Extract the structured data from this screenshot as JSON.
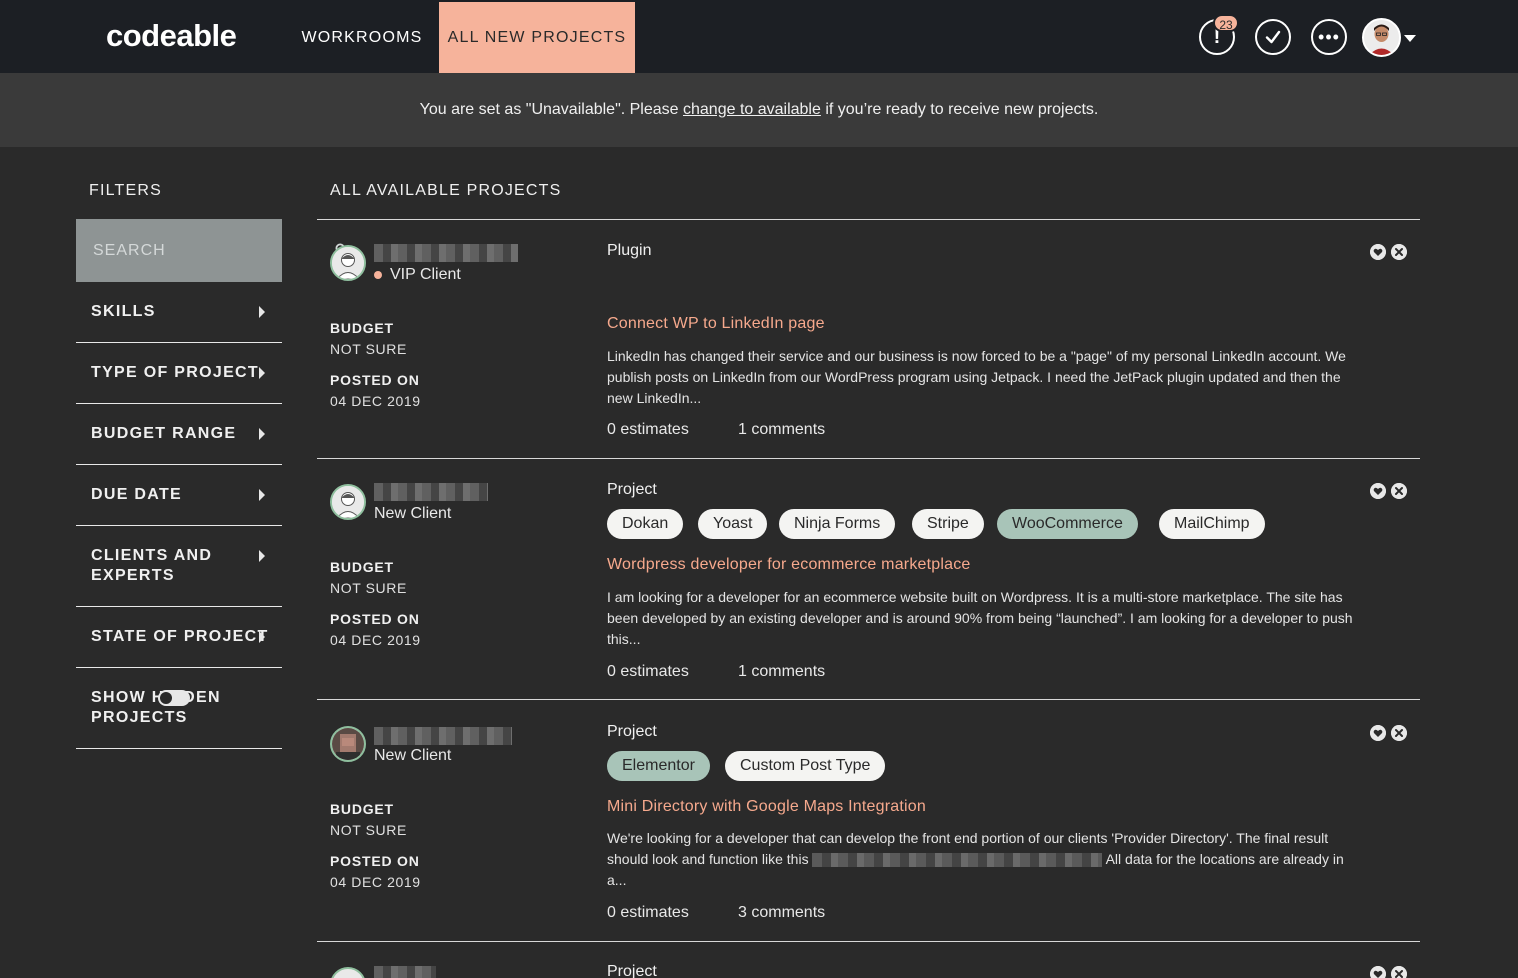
{
  "app": {
    "logo": "codeable"
  },
  "nav": {
    "workrooms": "WORKROOMS",
    "all_new_projects": "ALL NEW PROJECTS"
  },
  "header": {
    "notification_count": "23",
    "more_label": "•••"
  },
  "banner": {
    "prefix": "You are set as \"Unavailable\". Please ",
    "link": "change to available",
    "suffix": " if you’re ready to receive new projects."
  },
  "sidebar": {
    "title": "FILTERS",
    "search_placeholder": "SEARCH",
    "filters": [
      {
        "label": "SKILLS"
      },
      {
        "label": "TYPE OF PROJECT"
      },
      {
        "label": "BUDGET RANGE"
      },
      {
        "label": "DUE DATE"
      },
      {
        "label": "CLIENTS AND EXPERTS"
      },
      {
        "label": "STATE OF PROJECT"
      }
    ],
    "show_hidden": "SHOW HIDDEN PROJECTS",
    "show_hidden_on": false
  },
  "main": {
    "title": "ALL AVAILABLE PROJECTS",
    "projects": [
      {
        "client_type": "VIP Client",
        "budget_label": "BUDGET",
        "budget": "NOT SURE",
        "posted_label": "POSTED ON",
        "posted": "04 DEC 2019",
        "type": "Plugin",
        "tags": [],
        "title": "Connect WP to LinkedIn page",
        "description": "LinkedIn has changed their service and our business is now forced to be a \"page\" of my personal LinkedIn account. We publish posts on LinkedIn from our WordPress program using Jetpack. I need the JetPack plugin updated and then the new LinkedIn...",
        "estimates": "0 estimates",
        "comments": "1 comments"
      },
      {
        "client_type": "New Client",
        "budget_label": "BUDGET",
        "budget": "NOT SURE",
        "posted_label": "POSTED ON",
        "posted": "04 DEC 2019",
        "type": "Project",
        "tags": [
          "Dokan",
          "Yoast",
          "Ninja Forms",
          "Stripe",
          "WooCommerce",
          "MailChimp"
        ],
        "title": "Wordpress developer for ecommerce marketplace",
        "description": "I am looking for a developer for an ecommerce website built on Wordpress. It is a multi-store marketplace. The site has been developed by an existing developer and is around 90% from being “launched”. I am looking for a developer to push this...",
        "estimates": "0 estimates",
        "comments": "1 comments"
      },
      {
        "client_type": "New Client",
        "budget_label": "BUDGET",
        "budget": "NOT SURE",
        "posted_label": "POSTED ON",
        "posted": "04 DEC 2019",
        "type": "Project",
        "tags": [
          "Elementor",
          "Custom Post Type"
        ],
        "title": "Mini Directory with Google Maps Integration",
        "description_a": "We're looking for a developer that can develop the front end portion of our clients 'Provider Directory'. The final result should look and function like this",
        "description_b": "All data for the locations are already in a...",
        "estimates": "0 estimates",
        "comments": "3 comments"
      },
      {
        "type": "Project"
      }
    ]
  }
}
